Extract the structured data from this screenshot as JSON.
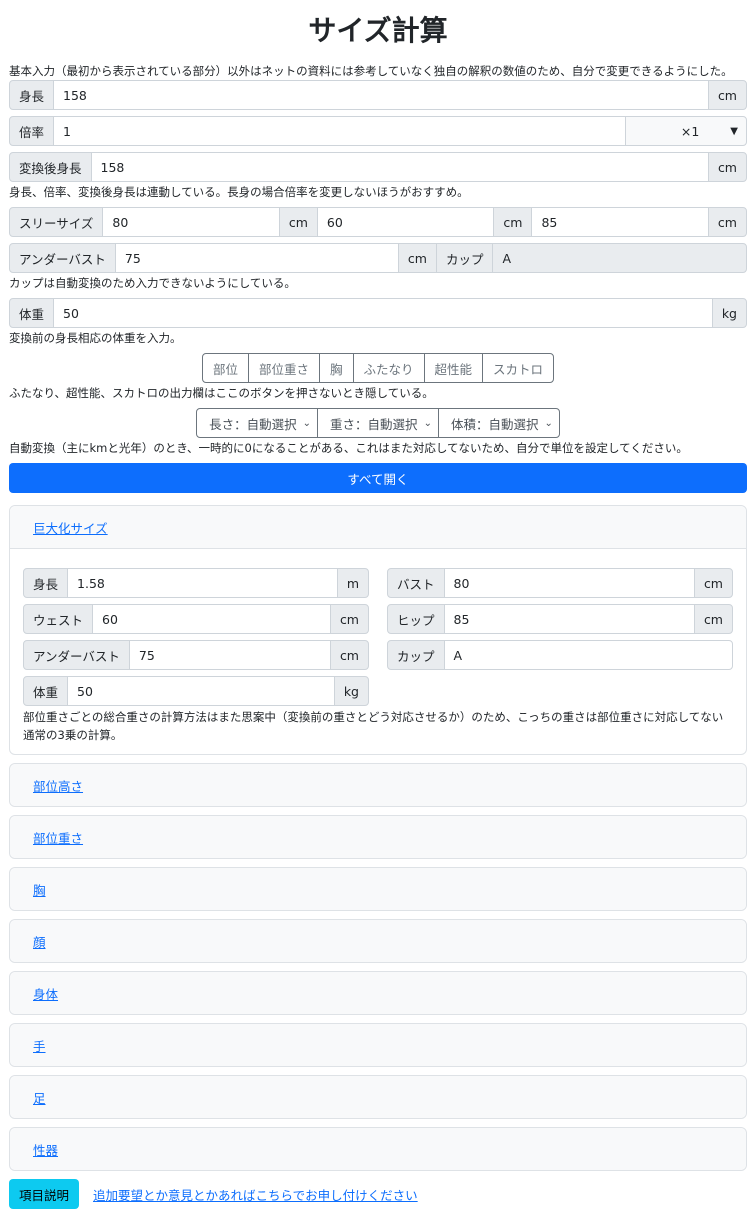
{
  "title": "サイズ計算",
  "note_basic": "基本入力（最初から表示されている部分）以外はネットの資料には参考していなく独自の解釈の数値のため、自分で変更できるようにした。",
  "height": {
    "label": "身長",
    "value": "158",
    "unit": "cm"
  },
  "ratio": {
    "label": "倍率",
    "value": "1",
    "select": "×1"
  },
  "converted_height": {
    "label": "変換後身長",
    "value": "158",
    "unit": "cm"
  },
  "note_linked": "身長、倍率、変換後身長は連動している。長身の場合倍率を変更しないほうがおすすめ。",
  "three_size": {
    "label": "スリーサイズ",
    "bust": "80",
    "waist": "60",
    "hip": "85",
    "unit": "cm"
  },
  "underbust": {
    "label": "アンダーバスト",
    "value": "75",
    "unit": "cm",
    "cup_label": "カップ",
    "cup_value": "A"
  },
  "note_cup": "カップは自動変換のため入力できないようにしている。",
  "weight": {
    "label": "体重",
    "value": "50",
    "unit": "kg"
  },
  "note_weight": "変換前の身長相応の体重を入力。",
  "toggles": [
    "部位",
    "部位重さ",
    "胸",
    "ふたなり",
    "超性能",
    "スカトロ"
  ],
  "note_toggles": "ふたなり、超性能、スカトロの出力欄はここのボタンを押さないとき隠している。",
  "unit_selects": [
    "長さ：自動選択",
    "重さ：自動選択",
    "体積：自動選択"
  ],
  "note_auto": "自動変換（主にkmと光年）のとき、一時的に0になることがある、これはまた対応してないため、自分で単位を設定してください。",
  "open_all": "すべて開く",
  "giant": {
    "header": "巨大化サイズ",
    "height": {
      "label": "身長",
      "value": "1.58",
      "unit": "m"
    },
    "bust": {
      "label": "バスト",
      "value": "80",
      "unit": "cm"
    },
    "waist": {
      "label": "ウェスト",
      "value": "60",
      "unit": "cm"
    },
    "hip": {
      "label": "ヒップ",
      "value": "85",
      "unit": "cm"
    },
    "underbust": {
      "label": "アンダーバスト",
      "value": "75",
      "unit": "cm"
    },
    "cup": {
      "label": "カップ",
      "value": "A"
    },
    "weight": {
      "label": "体重",
      "value": "50",
      "unit": "kg"
    },
    "note": "部位重さごとの総合重さの計算方法はまた思案中（変換前の重さとどう対応させるか）のため、こっちの重さは部位重さに対応してない通常の3乗の計算。"
  },
  "sections": [
    "部位高さ",
    "部位重さ",
    "胸",
    "顔",
    "身体",
    "手",
    "足",
    "性器"
  ],
  "footer": {
    "info_button": "項目説明",
    "link": "追加要望とか意見とかあればこちらでお申し付けください"
  }
}
